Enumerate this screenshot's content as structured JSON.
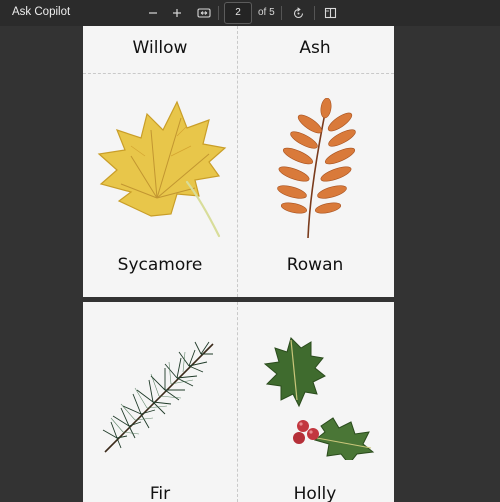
{
  "toolbar": {
    "title": "Ask Copilot",
    "zoom_out_icon": "minus-icon",
    "zoom_in_icon": "plus-icon",
    "fit_icon": "fit-page-icon",
    "current_page": "2",
    "page_total": "of 5",
    "rotate_icon": "rotate-icon",
    "view_icon": "page-view-icon"
  },
  "pages": [
    {
      "top_labels": [
        "Willow",
        "Ash"
      ],
      "cards": [
        {
          "name": "Sycamore",
          "illustration": "sycamore-leaf"
        },
        {
          "name": "Rowan",
          "illustration": "rowan-leaf"
        }
      ]
    },
    {
      "cards": [
        {
          "name": "Fir",
          "illustration": "fir-branch"
        },
        {
          "name": "Holly",
          "illustration": "holly-leaves"
        }
      ]
    }
  ],
  "colors": {
    "background": "#333333",
    "toolbar": "#2b2b2b",
    "page": "#f5f5f5",
    "sycamore": "#e8c64a",
    "rowan": "#d97a3a",
    "fir": "#1f3a28",
    "holly": "#3f6b2e",
    "berry": "#c2373f"
  }
}
